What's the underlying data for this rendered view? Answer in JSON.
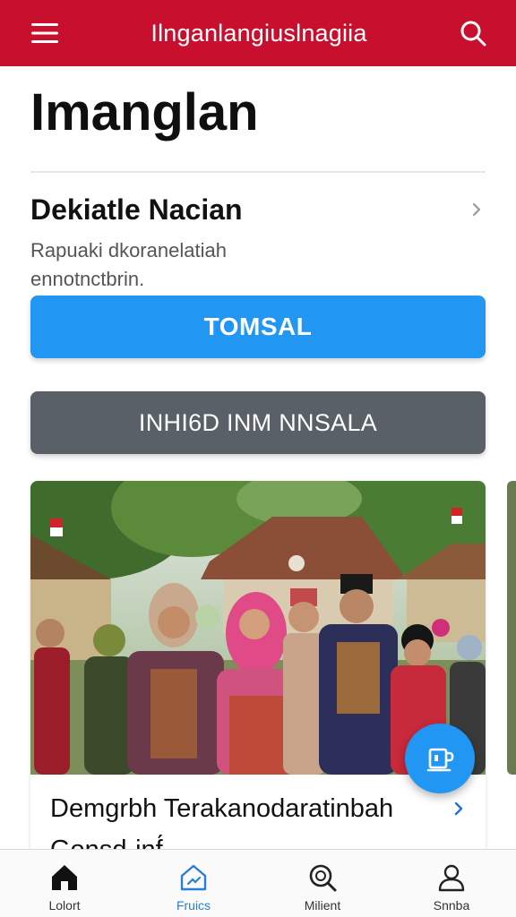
{
  "appbar": {
    "title": "Ilnganlangiuslnagiia",
    "menu_icon": "hamburger-menu-icon",
    "search_icon": "search-icon",
    "color": "#c8102e"
  },
  "page": {
    "title": "Imanglan"
  },
  "section": {
    "heading": "Dekiatle Nacian",
    "description": "Rapuaki dkoranelatiah ennotnctbrin.",
    "chevron_icon": "chevron-right-icon"
  },
  "buttons": {
    "primary_label": "TOMSAL",
    "primary_color": "#2196f3",
    "secondary_label": "INHI6D INM NNSALA",
    "secondary_color": "#5a6068"
  },
  "card": {
    "image_alt": "Group of people in traditional clothing in front of a village house",
    "caption_line1": "Demgrbh Terakanodaratinbah",
    "caption_line2": "Gonsd·inf́",
    "chevron_icon": "chevron-right-icon"
  },
  "fab": {
    "icon": "cup-icon"
  },
  "bottom_nav": {
    "items": [
      {
        "label": "Lolort",
        "icon": "home-icon",
        "active": false
      },
      {
        "label": "Fruics",
        "icon": "house-outline-icon",
        "active": true
      },
      {
        "label": "Milient",
        "icon": "search-icon",
        "active": false
      },
      {
        "label": "Snnba",
        "icon": "person-icon",
        "active": false
      }
    ]
  }
}
